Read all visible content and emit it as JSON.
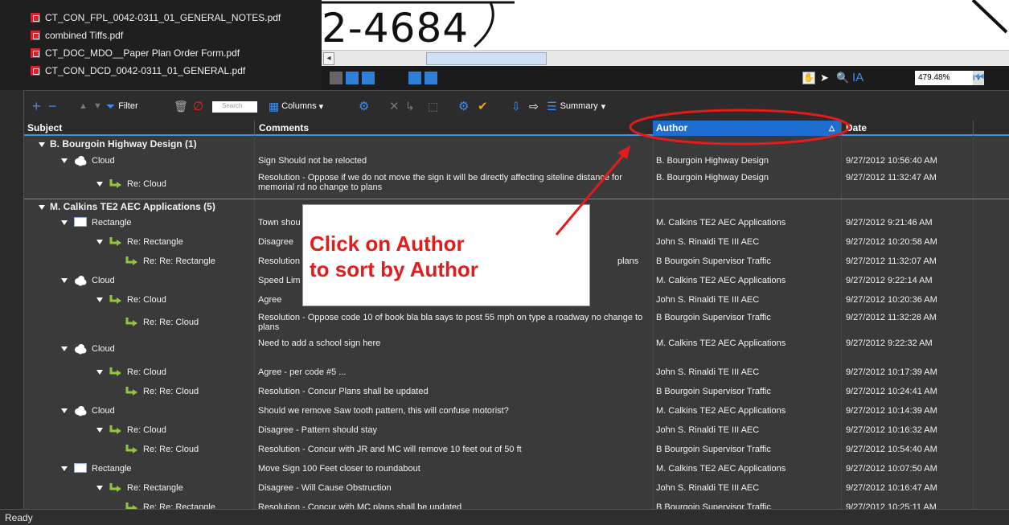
{
  "files": [
    "CT_CON_FPL_0042-0311_01_GENERAL_NOTES.pdf",
    "combined Tiffs.pdf",
    "CT_DOC_MDO__Paper Plan Order Form.pdf",
    "CT_CON_DCD_0042-0311_01_GENERAL.pdf"
  ],
  "viewer": {
    "drawing_text": "2-4684",
    "zoom": "479.48%"
  },
  "toolbar": {
    "filter_label": "Filter",
    "search_placeholder": "Search",
    "columns_label": "Columns",
    "summary_label": "Summary"
  },
  "columns": {
    "subject": "Subject",
    "comments": "Comments",
    "author": "Author",
    "date": "Date"
  },
  "groups": [
    {
      "label": "B. Bourgoin Highway Design (1)"
    },
    {
      "label": "M. Calkins TE2 AEC Applications (5)"
    }
  ],
  "rows": [
    {
      "subject": "Cloud",
      "comment": "Sign Should not be relocted",
      "author": "B. Bourgoin Highway Design",
      "date": "9/27/2012 10:56:40 AM"
    },
    {
      "subject": "Re: Cloud",
      "comment": "Resolution - Oppose if we do not move the sign it will be directly affecting siteline distance for memorial rd no change to plans",
      "author": "B. Bourgoin Highway Design",
      "date": "9/27/2012 11:32:47 AM"
    },
    {
      "subject": "Rectangle",
      "comment": "Town shou",
      "author": "M. Calkins TE2 AEC Applications",
      "date": "9/27/2012 9:21:46 AM"
    },
    {
      "subject": "Re: Rectangle",
      "comment": "Disagree",
      "author": "John S. Rinaldi TE III AEC",
      "date": "9/27/2012 10:20:58 AM"
    },
    {
      "subject": "Re: Re: Rectangle",
      "comment": "Resolution",
      "comment_tail": "plans",
      "author": "B Bourgoin Supervisor Traffic",
      "date": "9/27/2012 11:32:07 AM"
    },
    {
      "subject": "Cloud",
      "comment": "Speed Lim",
      "author": "M. Calkins TE2 AEC Applications",
      "date": "9/27/2012 9:22:14 AM"
    },
    {
      "subject": "Re: Cloud",
      "comment": "Agree",
      "author": "John S. Rinaldi TE III AEC",
      "date": "9/27/2012 10:20:36 AM"
    },
    {
      "subject": "Re: Re: Cloud",
      "comment": "Resolution - Oppose code 10 of book bla bla says to post 55 mph on type a roadway no change to plans",
      "author": "B Bourgoin Supervisor Traffic",
      "date": "9/27/2012 11:32:28 AM"
    },
    {
      "subject": "Cloud",
      "comment": "Need to add a school sign here",
      "author": "M. Calkins TE2 AEC Applications",
      "date": "9/27/2012 9:22:32 AM"
    },
    {
      "subject": "Re: Cloud",
      "comment": "Agree - per code #5 ...",
      "author": "John S. Rinaldi TE III AEC",
      "date": "9/27/2012 10:17:39 AM"
    },
    {
      "subject": "Re: Re: Cloud",
      "comment": "Resolution - Concur Plans shall be updated",
      "author": "B Bourgoin Supervisor Traffic",
      "date": "9/27/2012 10:24:41 AM"
    },
    {
      "subject": "Cloud",
      "comment": "Should we remove Saw tooth pattern, this will confuse motorist?",
      "author": "M. Calkins TE2 AEC Applications",
      "date": "9/27/2012 10:14:39 AM"
    },
    {
      "subject": "Re: Cloud",
      "comment": "Disagree - Pattern should stay",
      "author": "John S. Rinaldi TE III AEC",
      "date": "9/27/2012 10:16:32 AM"
    },
    {
      "subject": "Re: Re: Cloud",
      "comment": "Resolution - Concur with JR and MC will remove 10 feet out of 50 ft",
      "author": "B Bourgoin Supervisor Traffic",
      "date": "9/27/2012 10:54:40 AM"
    },
    {
      "subject": "Rectangle",
      "comment": "Move Sign 100 Feet closer to roundabout",
      "author": "M. Calkins TE2 AEC Applications",
      "date": "9/27/2012 10:07:50 AM"
    },
    {
      "subject": "Re: Rectangle",
      "comment": "Disagree - Will Cause Obstruction",
      "author": "John S. Rinaldi TE III AEC",
      "date": "9/27/2012 10:16:47 AM"
    },
    {
      "subject": "Re: Re: Rectangle",
      "comment": "Resolution - Concur with MC plans shall be updated",
      "author": "B Bourgoin Supervisor Traffic",
      "date": "9/27/2012 10:25:11 AM"
    }
  ],
  "callout": {
    "text": "Click on Author\nto sort by Author"
  },
  "status": "Ready",
  "colors": {
    "accent": "#1e6dd1",
    "callout_red": "#e21c1c",
    "background": "#3a3a3a"
  }
}
